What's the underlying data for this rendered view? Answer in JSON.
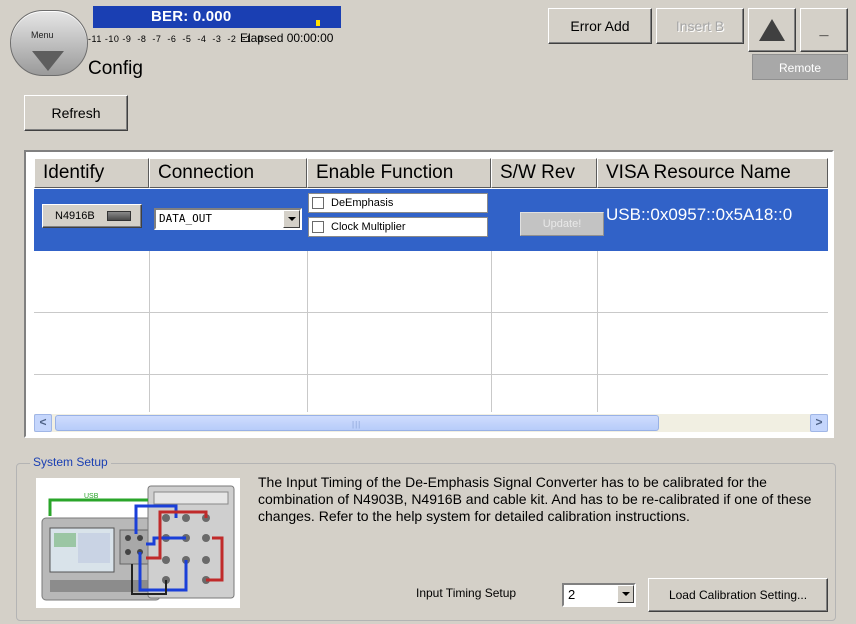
{
  "header": {
    "menu_label": "Menu",
    "ber_label": "BER: 0.000",
    "ber_scale": "-11 -10 -9  -8  -7  -6  -5  -4  -3  -2  -1  0",
    "elapsed": "Elapsed 00:00:00",
    "page_title": "Config",
    "error_add": "Error Add",
    "insert_b": "Insert B",
    "minimize": "_",
    "remote": "Remote",
    "icons": {
      "menu": "down-arrow-icon",
      "warning": "warning-triangle-icon"
    }
  },
  "toolbar": {
    "refresh": "Refresh"
  },
  "table": {
    "columns": [
      "Identify",
      "Connection",
      "Enable Function",
      "S/W Rev",
      "VISA Resource Name"
    ],
    "rows": [
      {
        "identify": "N4916B",
        "connection": "DATA_OUT",
        "functions": [
          {
            "label": "DeEmphasis",
            "checked": false
          },
          {
            "label": "Clock Multiplier",
            "checked": false
          }
        ],
        "sw_rev_button": "Update!",
        "visa": "USB::0x0957::0x5A18::0"
      }
    ],
    "scrollbar": {
      "left_glyph": "<",
      "right_glyph": ">",
      "grip": "|||"
    }
  },
  "system_setup": {
    "legend": "System Setup",
    "description": "The Input Timing of the De-Emphasis Signal Converter has to be calibrated for the combination of N4903B, N4916B and cable kit. And has to be re-calibrated if one of these changes. Refer to the help system for detailed calibration instructions.",
    "usb_label": "USB",
    "input_timing_label": "Input Timing Setup",
    "input_timing_value": "2",
    "load_button": "Load Calibration Setting..."
  },
  "colors": {
    "selection": "#3162c8",
    "ber_background": "#1a3fb3",
    "window_background": "#d4d0c8"
  }
}
